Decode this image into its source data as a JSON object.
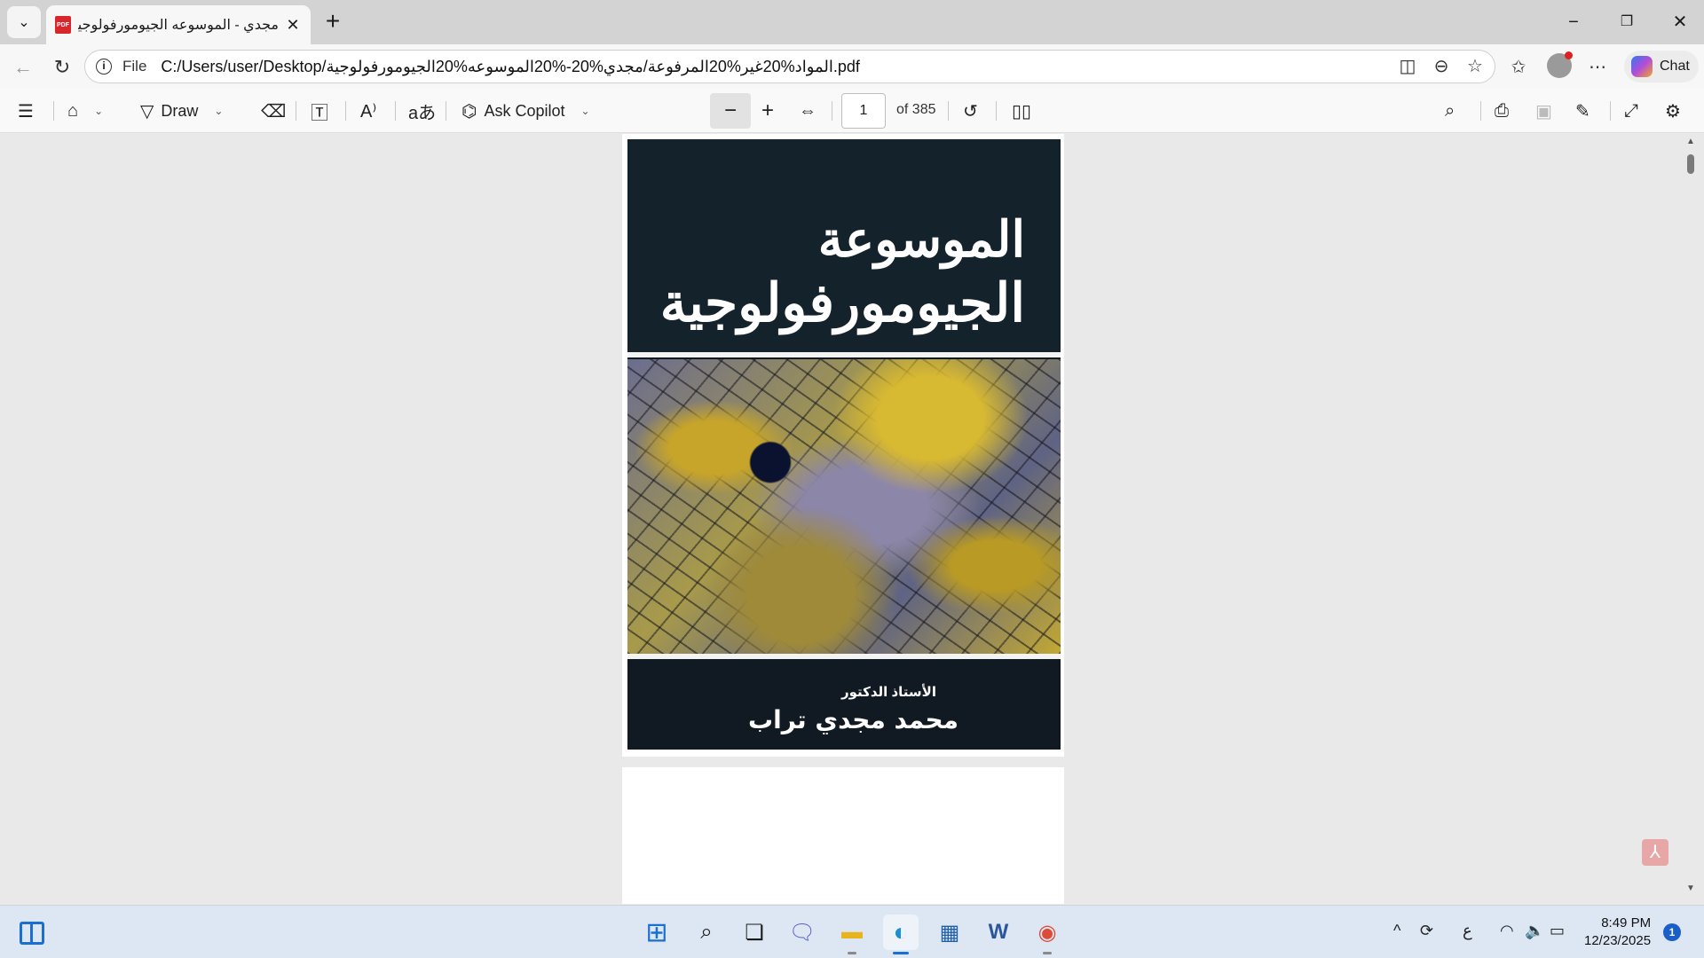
{
  "tab": {
    "title": "مجدي - الموسوعه الجيومورفولوجية.pdf",
    "favicon_label": "PDF"
  },
  "address": {
    "scheme_label": "File",
    "url": "C:/Users/user/Desktop/المواد%20غير%20المرفوعة/مجدي%20-%20الموسوعه%20الجيومورفولوجية.pdf"
  },
  "copilot": {
    "label": "Chat"
  },
  "pdf_toolbar": {
    "draw_label": "Draw",
    "ask_copilot_label": "Ask Copilot",
    "page_current": "1",
    "page_total": "of 385"
  },
  "cover": {
    "title_line1": "الموسوعة",
    "title_line2": "الجيومورفولوجية",
    "author_label": "الأستاذ الدكتور",
    "author_name": "محمد مجدي تراب"
  },
  "taskbar": {
    "input_indicator": "ع",
    "time": "8:49 PM",
    "date": "12/23/2025",
    "notification_count": "1"
  },
  "colors": {
    "accent": "#1a6fd1",
    "pdf_red": "#d9262d"
  }
}
